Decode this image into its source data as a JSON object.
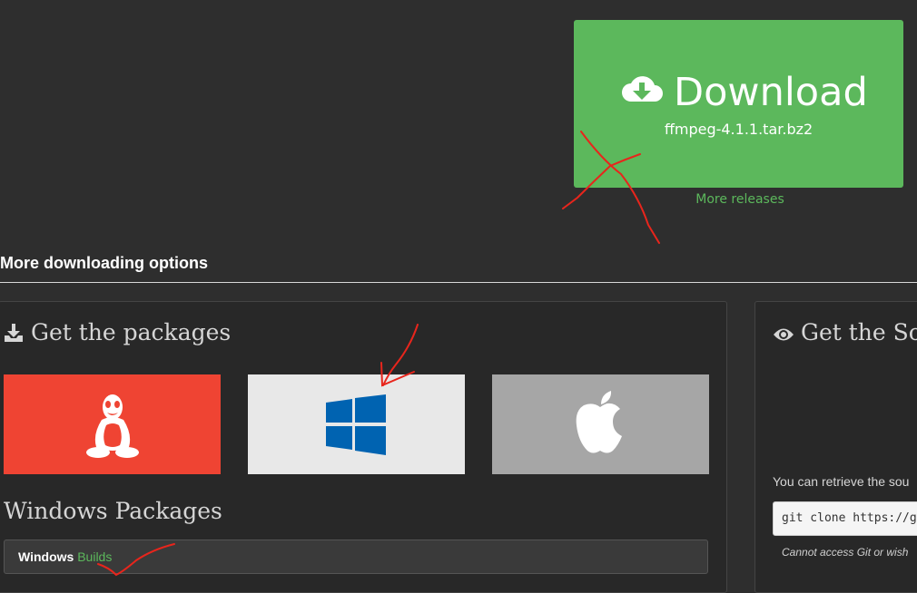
{
  "download": {
    "title": "Download",
    "file": "ffmpeg-4.1.1.tar.bz2",
    "more_releases": "More releases",
    "icon": "cloud-download-icon"
  },
  "options_heading": "More downloading options",
  "packages": {
    "heading": "Get the packages",
    "heading_icon": "download-tray-icon",
    "tiles": [
      {
        "name": "linux",
        "icon": "tux-icon",
        "color": "#ef4433"
      },
      {
        "name": "windows",
        "icon": "windows-logo-icon",
        "color": "#e8e8e8"
      },
      {
        "name": "mac",
        "icon": "apple-logo-icon",
        "color": "#a6a6a6"
      }
    ],
    "windows_heading": "Windows Packages",
    "windows_builds": {
      "label": "Windows",
      "link": "Builds"
    }
  },
  "source": {
    "heading": "Get the Sou",
    "heading_icon": "eye-icon",
    "text": "You can retrieve the sou",
    "code": "git clone https://git",
    "note": "Cannot access Git or wish"
  },
  "colors": {
    "accent_green": "#5cb85c",
    "background": "#2e2e2e",
    "annotation_red": "#e8251c"
  }
}
